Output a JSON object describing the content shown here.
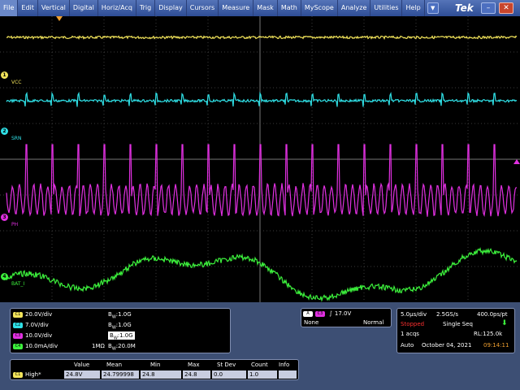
{
  "menu": [
    "File",
    "Edit",
    "Vertical",
    "Digital",
    "Horiz/Acq",
    "Trig",
    "Display",
    "Cursors",
    "Measure",
    "Mask",
    "Math",
    "MyScope",
    "Analyze",
    "Utilities",
    "Help"
  ],
  "brand": "Tek",
  "colors": {
    "ch1": "#f1e35a",
    "ch2": "#2fe0e6",
    "ch3": "#e030e0",
    "ch4": "#3cf03c",
    "accent": "#2e4d96"
  },
  "channels": [
    {
      "id": "1",
      "name": "VCC",
      "scale": "20.0V/div",
      "impedance": "",
      "bw": "1.0G"
    },
    {
      "id": "2",
      "name": "SRN",
      "scale": "7.0V/div",
      "impedance": "",
      "bw": "1.0G"
    },
    {
      "id": "3",
      "name": "PH",
      "scale": "10.0V/div",
      "impedance": "",
      "bw": "1.0G"
    },
    {
      "id": "4",
      "name": "BAT_I",
      "scale": "10.0mA/div",
      "impedance": "1MΩ",
      "bw": "20.0M"
    }
  ],
  "bw_prefix": "B",
  "bw_sub": "W",
  "trigger": {
    "badge": "A",
    "source": "C3",
    "level": "17.0V",
    "coupling": "None",
    "mode": "Normal"
  },
  "horizontal": {
    "timebase": "5.0μs/div",
    "sample_rate": "2.5GS/s",
    "resolution": "400.0ps/pt",
    "state": "Stopped",
    "seq": "Single Seq",
    "acqs": "1 acqs",
    "record": "RL:125.0k",
    "mode": "Auto",
    "date": "October 04, 2021",
    "time": "09:14:11"
  },
  "measurements": {
    "headers": [
      "Value",
      "Mean",
      "Min",
      "Max",
      "St Dev",
      "Count",
      "Info"
    ],
    "rows": [
      {
        "channel": "C1",
        "name": "High*",
        "values": [
          "24.8V",
          "24.799998",
          "24.8",
          "24.8",
          "0.0",
          "1.0",
          ""
        ]
      }
    ]
  }
}
